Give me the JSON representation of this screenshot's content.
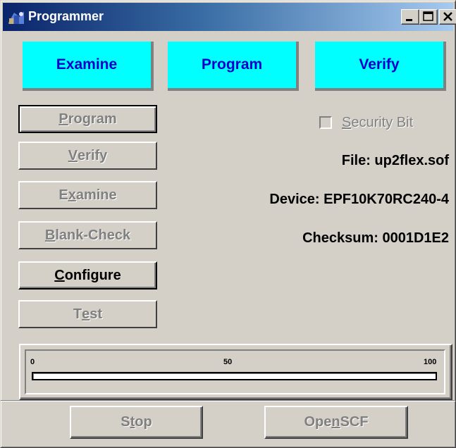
{
  "window": {
    "title": "Programmer",
    "controls": [
      "minimize",
      "maximize",
      "close"
    ]
  },
  "mode_tabs": [
    {
      "label": "Examine"
    },
    {
      "label": "Program"
    },
    {
      "label": "Verify"
    }
  ],
  "actions": [
    {
      "pre": "",
      "key": "P",
      "post": "rogram",
      "enabled": false,
      "focused": true
    },
    {
      "pre": "",
      "key": "V",
      "post": "erify",
      "enabled": false,
      "focused": false
    },
    {
      "pre": "E",
      "key": "x",
      "post": "amine",
      "enabled": false,
      "focused": false
    },
    {
      "pre": "",
      "key": "B",
      "post": "lank-Check",
      "enabled": false,
      "focused": false
    },
    {
      "pre": "",
      "key": "C",
      "post": "onfigure",
      "enabled": true,
      "focused": false
    },
    {
      "pre": "T",
      "key": "e",
      "post": "st",
      "enabled": false,
      "focused": false
    }
  ],
  "security_bit": {
    "key": "S",
    "post": "ecurity Bit",
    "checked": false,
    "enabled": false
  },
  "info": {
    "file": "File: up2flex.sof",
    "device": "Device: EPF10K70RC240-4",
    "checksum": "Checksum: 0001D1E2"
  },
  "progress": {
    "tick_labels": [
      "0",
      "50",
      "100"
    ],
    "value_percent": 0
  },
  "bottom_buttons": {
    "stop": {
      "pre": "S",
      "key": "t",
      "post": "op",
      "enabled": false
    },
    "open_scf": {
      "pre": "Ope",
      "key": "n",
      "post": " SCF",
      "enabled": false
    }
  },
  "colors": {
    "tab_bg": "#00ffff",
    "tab_text": "#0000cc",
    "title_start": "#0a246a",
    "title_end": "#a6caf0",
    "face": "#d4d0c8"
  }
}
